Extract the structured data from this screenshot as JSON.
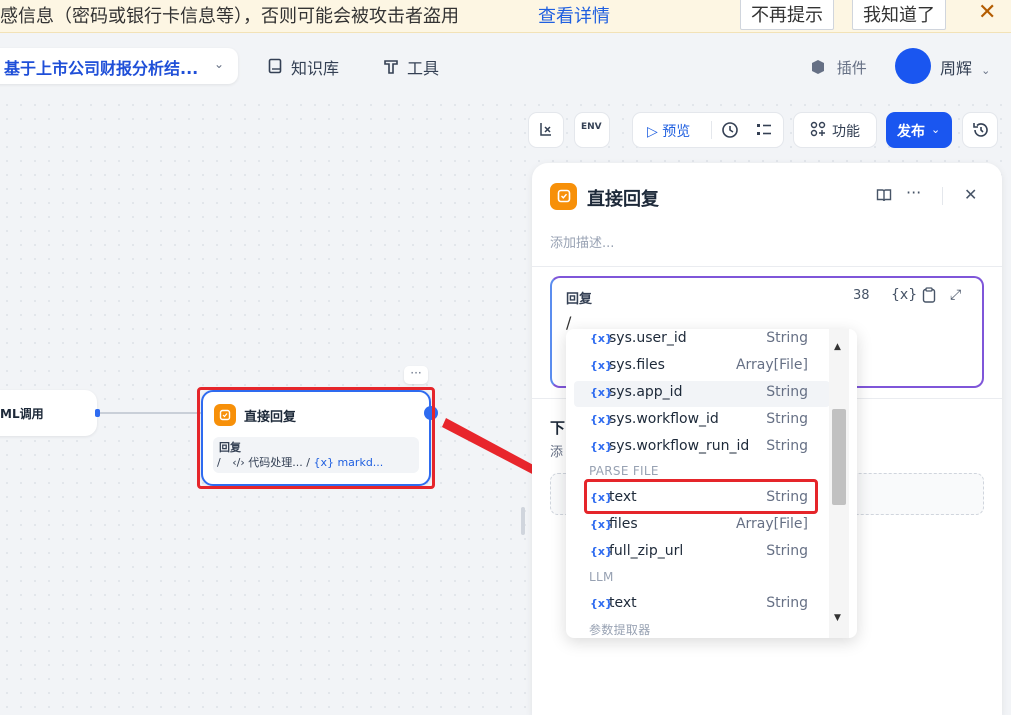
{
  "banner": {
    "message": "感信息（密码或银行卡信息等），否则可能会被攻击者盗用",
    "detail_link": "查看详情",
    "dont_remind": "不再提示",
    "got_it": "我知道了",
    "close": "✕"
  },
  "topbar": {
    "app_name": "基于上市公司财报分析结...",
    "nav": [
      {
        "label": "知识库",
        "icon": "book-icon"
      },
      {
        "label": "工具",
        "icon": "tool-icon"
      }
    ],
    "plugins": "插件",
    "user": "周辉"
  },
  "toolbar": {
    "preview": "预览",
    "features": "功能",
    "publish": "发布"
  },
  "canvas": {
    "left_node": "ML调用",
    "node": {
      "title": "直接回复",
      "field_label": "回复",
      "field_value_prefix": "/",
      "field_value_mid": "代码处理...",
      "field_value_sep": "/",
      "field_value_var": "markd..."
    }
  },
  "panel": {
    "title": "直接回复",
    "description_placeholder": "添加描述...",
    "reply_label": "回复",
    "char_count": "38",
    "input_cursor": "/",
    "next_step_title": "下",
    "next_step_desc": "添"
  },
  "dropdown": {
    "items": [
      {
        "kind": "var",
        "name": "sys.user_id",
        "type": "String"
      },
      {
        "kind": "var",
        "name": "sys.files",
        "type": "Array[File]"
      },
      {
        "kind": "var",
        "name": "sys.app_id",
        "type": "String"
      },
      {
        "kind": "var",
        "name": "sys.workflow_id",
        "type": "String"
      },
      {
        "kind": "var",
        "name": "sys.workflow_run_id",
        "type": "String"
      },
      {
        "kind": "group",
        "name": "PARSE FILE"
      },
      {
        "kind": "var",
        "name": "text",
        "type": "String"
      },
      {
        "kind": "var",
        "name": "files",
        "type": "Array[File]"
      },
      {
        "kind": "var",
        "name": "full_zip_url",
        "type": "String"
      },
      {
        "kind": "group",
        "name": "LLM"
      },
      {
        "kind": "var",
        "name": "text",
        "type": "String"
      },
      {
        "kind": "group",
        "name": "参数提取器"
      }
    ]
  },
  "colors": {
    "accent": "#2e6bf0",
    "highlight": "#e5252a",
    "node_icon": "#f79009"
  }
}
